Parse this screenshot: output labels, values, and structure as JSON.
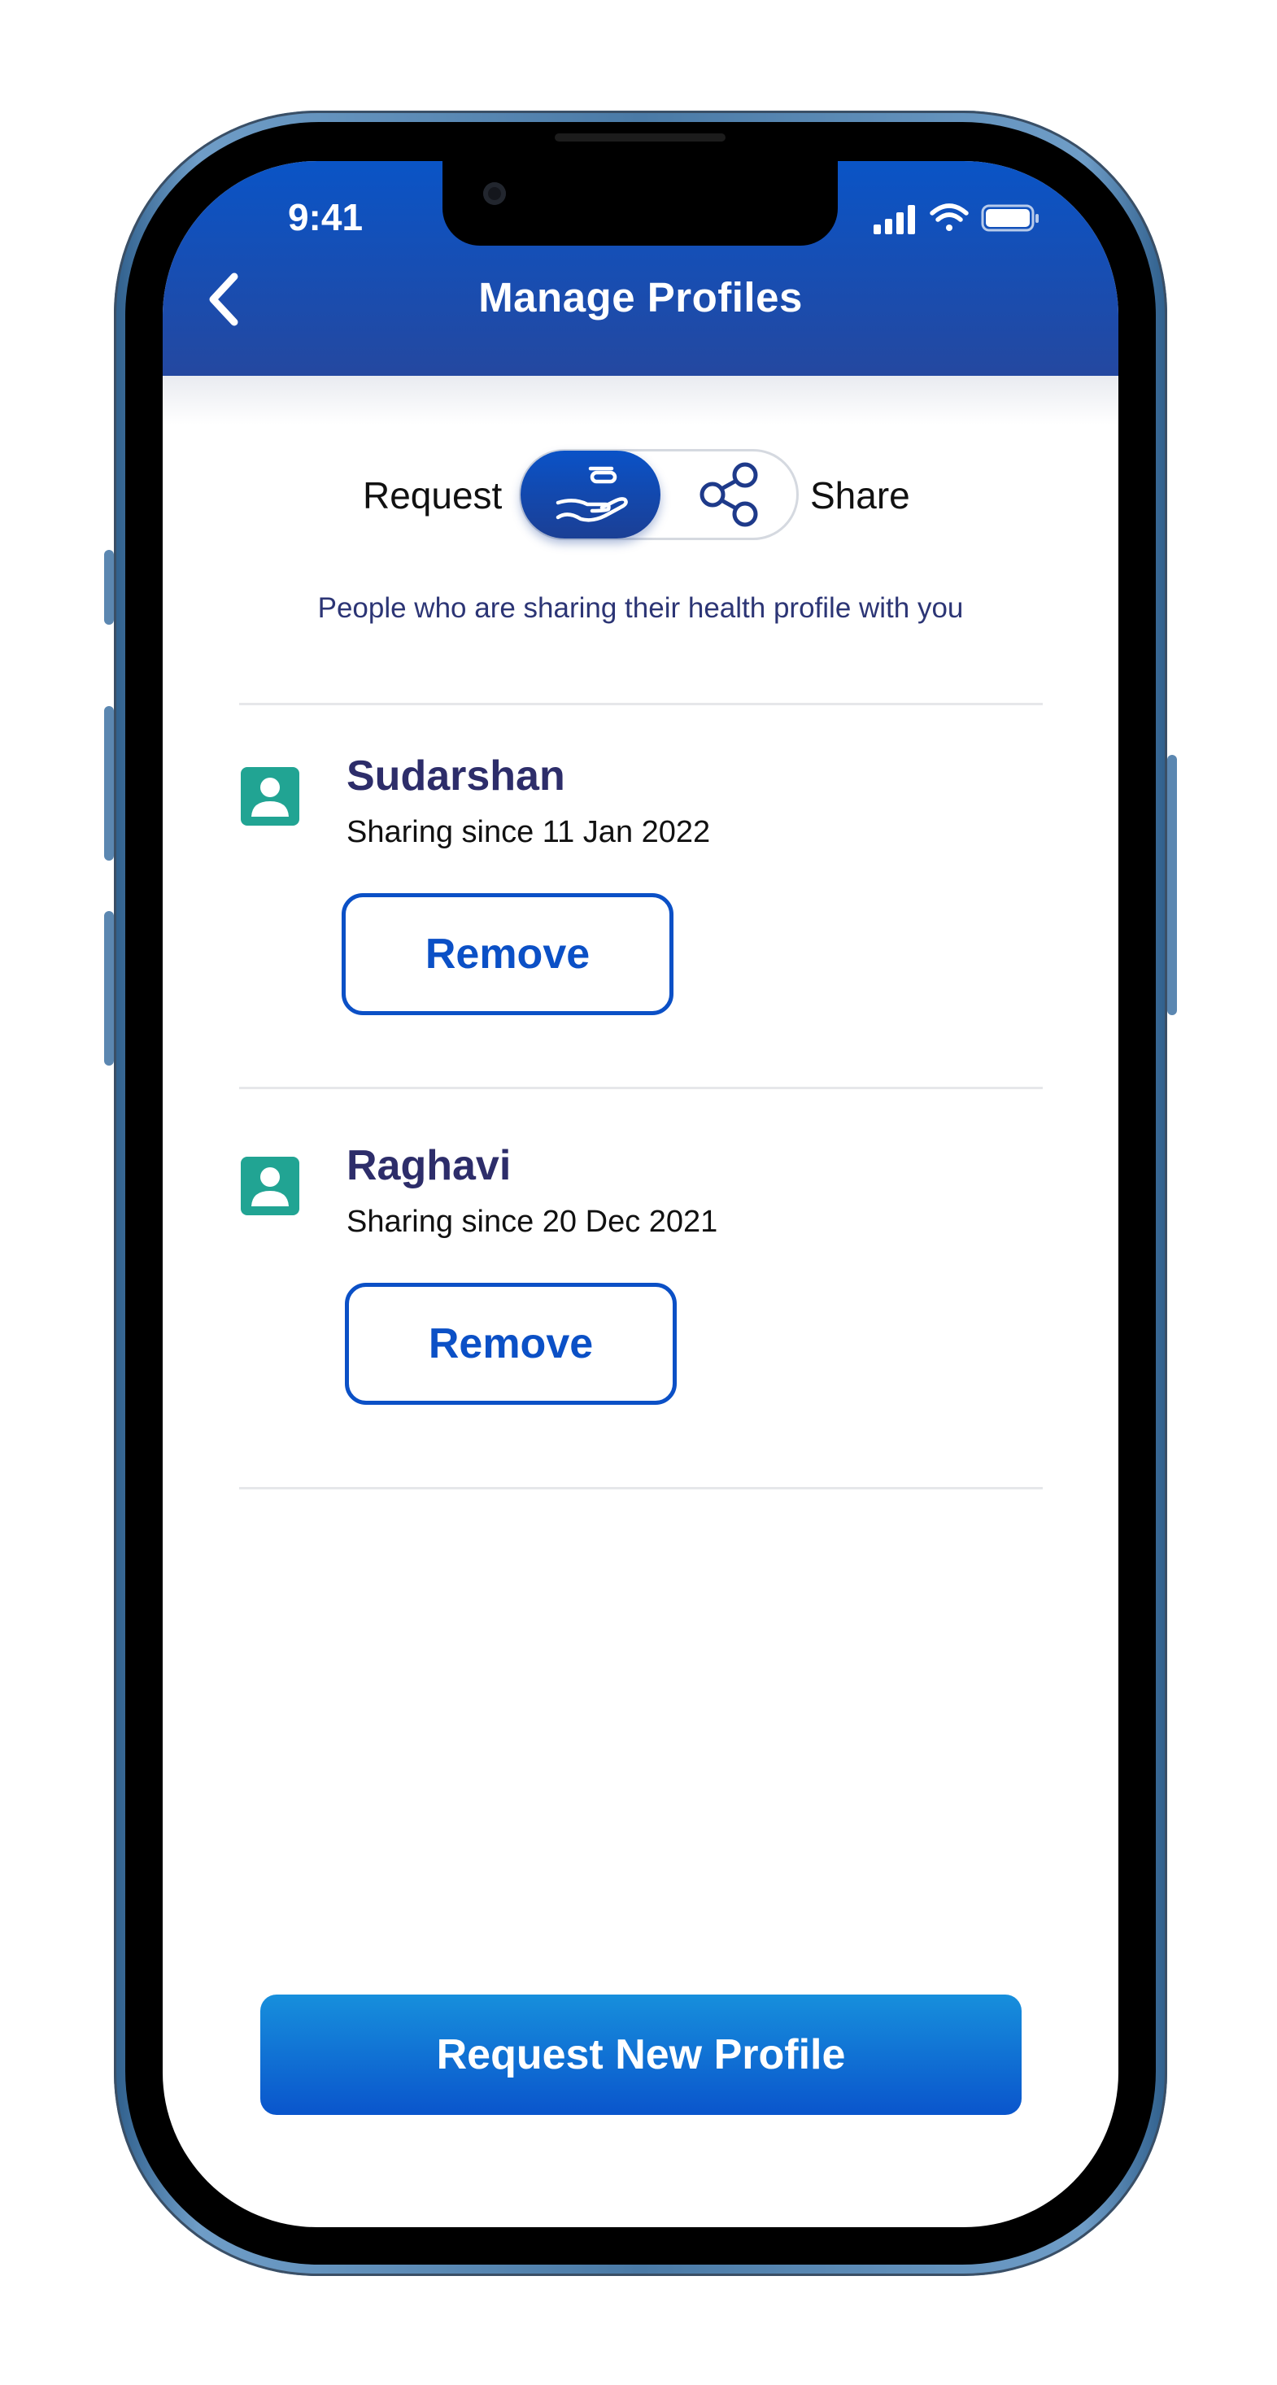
{
  "status_bar": {
    "time": "9:41"
  },
  "header": {
    "title": "Manage Profiles",
    "back_icon": "chevron-left-icon"
  },
  "toggle": {
    "left_label": "Request",
    "right_label": "Share",
    "selected": "Request",
    "left_icon": "hand-receive-icon",
    "right_icon": "share-icon"
  },
  "subtitle": "People who are sharing their health profile with you",
  "profiles": [
    {
      "name": "Sudarshan",
      "meta": "Sharing since 11 Jan 2022",
      "action": "Remove"
    },
    {
      "name": "Raghavi",
      "meta": "Sharing since 20 Dec 2021",
      "action": "Remove"
    }
  ],
  "cta": {
    "label": "Request New Profile"
  },
  "colors": {
    "primary": "#0b50c6",
    "header_dark": "#2448a0",
    "avatar": "#21a493",
    "text_dark": "#2d2d6a"
  }
}
